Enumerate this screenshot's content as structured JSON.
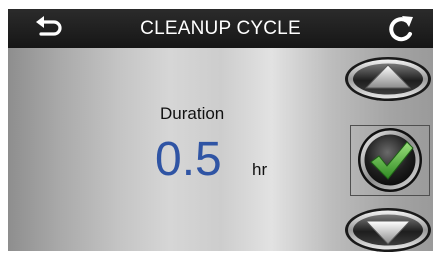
{
  "header": {
    "title": "CLEANUP CYCLE",
    "back_icon": "back-arrow-icon",
    "refresh_icon": "refresh-icon"
  },
  "setting": {
    "label": "Duration",
    "value": "0.5",
    "unit": "hr"
  },
  "controls": {
    "up_icon": "arrow-up-icon",
    "confirm_icon": "checkmark-icon",
    "down_icon": "arrow-down-icon"
  },
  "colors": {
    "value_text": "#2f54a4",
    "checkmark": "#3a9a2e",
    "titlebar": "#1c1c1c"
  }
}
